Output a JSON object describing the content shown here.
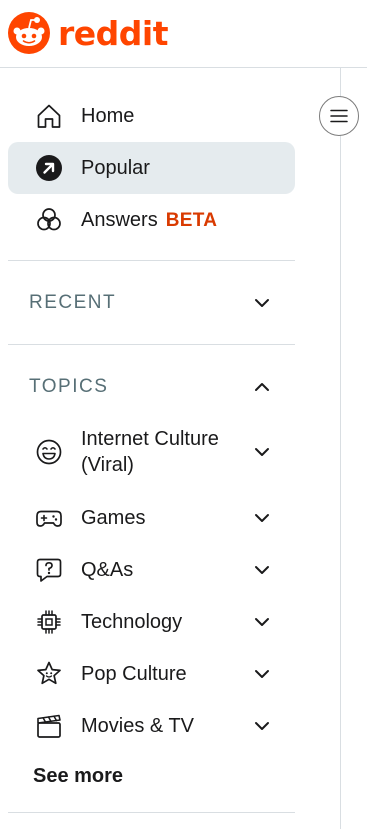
{
  "brand": {
    "name": "reddit",
    "accent": "#ff4500"
  },
  "nav": {
    "items": [
      {
        "label": "Home",
        "icon": "home-icon",
        "active": false
      },
      {
        "label": "Popular",
        "icon": "popular-arrow-icon",
        "active": true
      },
      {
        "label": "Answers",
        "badge": "BETA",
        "icon": "answers-icon",
        "active": false
      }
    ]
  },
  "recent": {
    "title": "RECENT",
    "expanded": false
  },
  "topics": {
    "title": "TOPICS",
    "expanded": true,
    "items": [
      {
        "line1": "Internet Culture",
        "line2": "(Viral)",
        "icon": "laughing-face-icon"
      },
      {
        "line1": "Games",
        "icon": "gamepad-icon"
      },
      {
        "line1": "Q&As",
        "icon": "question-bubble-icon"
      },
      {
        "line1": "Technology",
        "icon": "chip-icon"
      },
      {
        "line1": "Pop Culture",
        "icon": "star-face-icon"
      },
      {
        "line1": "Movies & TV",
        "icon": "clapperboard-icon"
      }
    ],
    "see_more": "See more"
  },
  "colors": {
    "active_bg": "#e5ebee",
    "beta": "#d93a00",
    "section_title": "#576f76",
    "divider": "#d9dee2"
  }
}
